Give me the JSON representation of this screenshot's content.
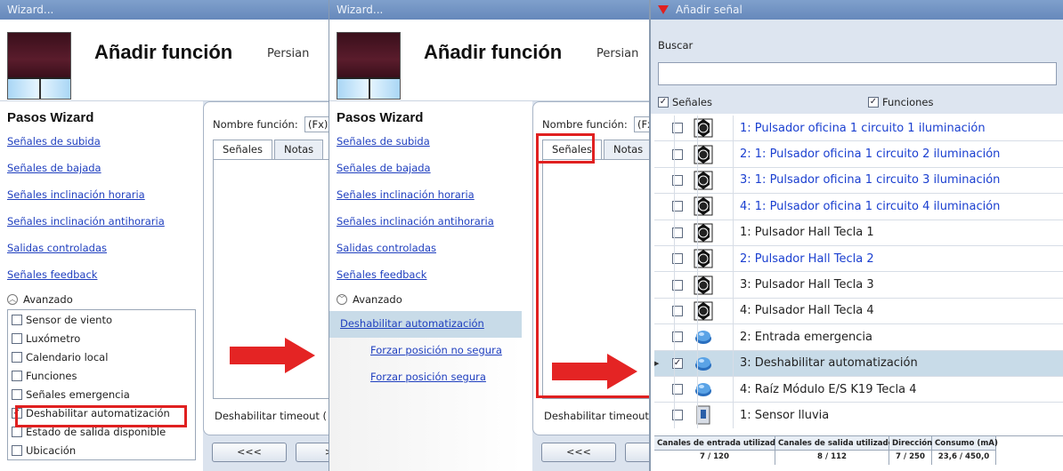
{
  "wizard": {
    "title": "Wizard...",
    "header_title": "Añadir función",
    "header_sub": "Persian",
    "steps_title": "Pasos Wizard",
    "steps": [
      "Señales de subida",
      "Señales de bajada",
      "Señales inclinación horaria",
      "Señales inclinación antihoraria",
      "Salidas controladas",
      "Señales feedback"
    ],
    "advanced_label": "Avanzado",
    "advanced_options": [
      {
        "label": "Sensor de viento",
        "checked": false
      },
      {
        "label": "Luxómetro",
        "checked": false
      },
      {
        "label": "Calendario local",
        "checked": false
      },
      {
        "label": "Funciones",
        "checked": false
      },
      {
        "label": "Señales emergencia",
        "checked": false
      },
      {
        "label": "Deshabilitar automatización",
        "checked": true
      },
      {
        "label": "Estado de salida disponible",
        "checked": false
      },
      {
        "label": "Ubicación",
        "checked": false
      }
    ],
    "advanced_steps": [
      "Deshabilitar automatización",
      "Forzar posición no segura",
      "Forzar posición segura"
    ],
    "function_name_label": "Nombre función:",
    "function_name_value": "(Fx)",
    "tabs": [
      "Señales",
      "Notas"
    ],
    "timeout_label": "Deshabilitar timeout (",
    "back_button": "<<<",
    "next_button": ">>"
  },
  "signal_dialog": {
    "title": "Añadir señal",
    "search_label": "Buscar",
    "search_value": "",
    "filter_signals": "Señales",
    "filter_functions": "Funciones",
    "rows": [
      {
        "text": "1: Pulsador oficina 1 circuito 1 iluminación",
        "checked": false,
        "icon": "button-icon",
        "color": "#1a3fd0"
      },
      {
        "text": "2: 1: Pulsador oficina 1 circuito 2 iluminación",
        "checked": false,
        "icon": "button-icon",
        "color": "#1a3fd0"
      },
      {
        "text": "3: 1: Pulsador oficina 1 circuito 3 iluminación",
        "checked": false,
        "icon": "button-icon",
        "color": "#1a3fd0"
      },
      {
        "text": "4: 1: Pulsador oficina 1 circuito 4 iluminación",
        "checked": false,
        "icon": "button-icon",
        "color": "#1a3fd0"
      },
      {
        "text": "1: Pulsador Hall Tecla 1",
        "checked": false,
        "icon": "button-icon",
        "color": "#222222"
      },
      {
        "text": "2: Pulsador Hall Tecla 2",
        "checked": false,
        "icon": "button-icon",
        "color": "#1a3fd0"
      },
      {
        "text": "3: Pulsador Hall Tecla 3",
        "checked": false,
        "icon": "button-icon",
        "color": "#222222"
      },
      {
        "text": "4: Pulsador Hall Tecla 4",
        "checked": false,
        "icon": "button-icon",
        "color": "#222222"
      },
      {
        "text": "2: Entrada emergencia",
        "checked": false,
        "icon": "input-icon",
        "color": "#222222"
      },
      {
        "text": "3: Deshabilitar automatización",
        "checked": true,
        "icon": "input-icon",
        "color": "#222222"
      },
      {
        "text": "4: Raíz Módulo E/S K19 Tecla 4",
        "checked": false,
        "icon": "input-icon",
        "color": "#222222"
      },
      {
        "text": "1: Sensor lluvia",
        "checked": false,
        "icon": "sensor-icon",
        "color": "#222222"
      }
    ],
    "status": {
      "input_label": "Canales de entrada utilizados",
      "input_value": "7 / 120",
      "output_label": "Canales de salida utilizados",
      "output_value": "8 / 112",
      "address_label": "Dirección",
      "address_value": "7 / 250",
      "consumption_label": "Consumo (mA)",
      "consumption_value": "23,6 / 450,0"
    }
  }
}
